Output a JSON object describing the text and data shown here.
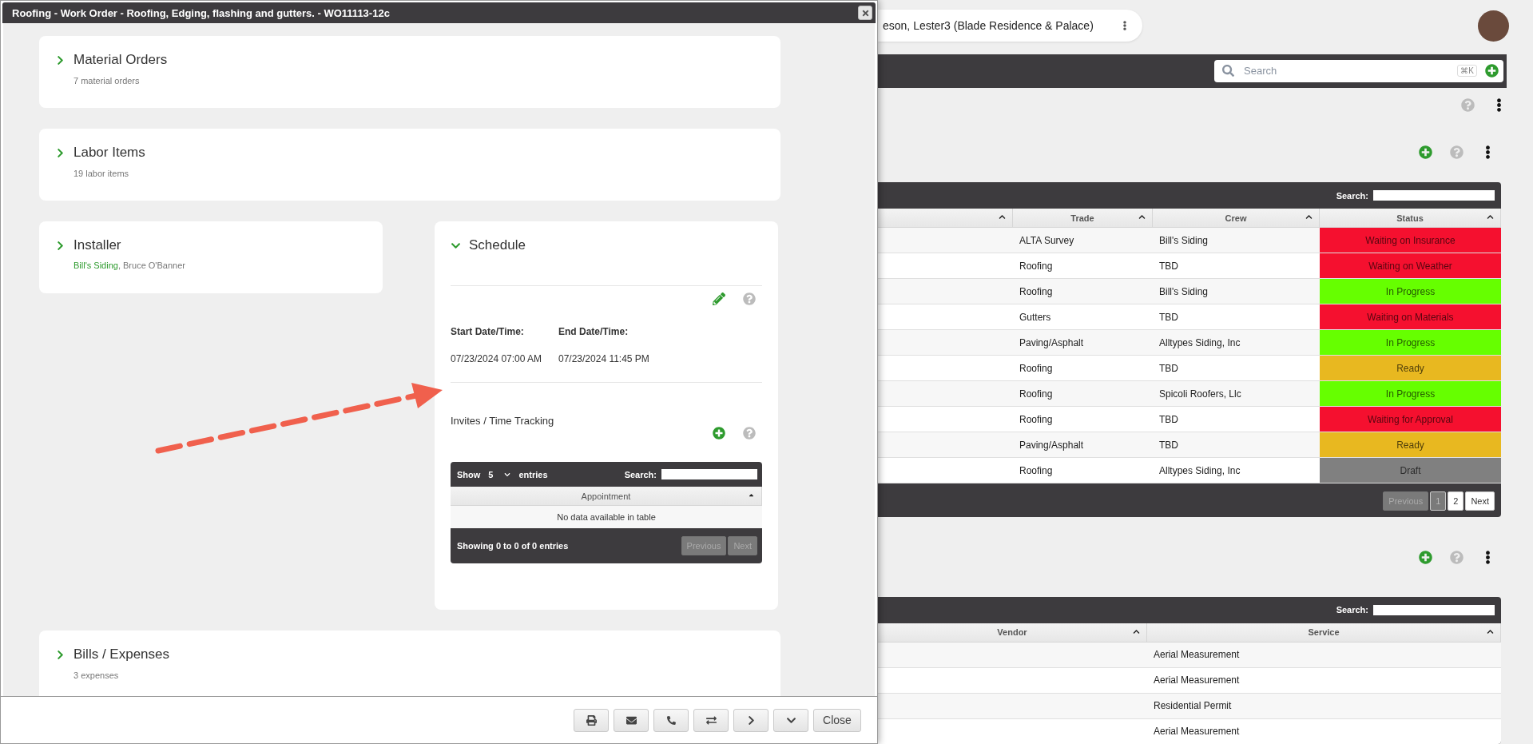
{
  "dialog": {
    "title": "Roofing - Work Order - Roofing, Edging, flashing and gutters. - WO11113-12c",
    "sections": [
      {
        "title": "Material Orders",
        "summary": "7 material orders",
        "expanded": false
      },
      {
        "title": "Labor Items",
        "summary": "19 labor items",
        "expanded": false
      }
    ],
    "installer": {
      "title": "Installer",
      "expanded": false,
      "company": "Bill's Siding",
      "rest": ", Bruce O'Banner"
    },
    "schedule": {
      "title": "Schedule",
      "expanded": true,
      "start_label": "Start Date/Time:",
      "start_value": "07/23/2024 07:00 AM",
      "end_label": "End Date/Time:",
      "end_value": "07/23/2024 11:45 PM",
      "invites_title": "Invites / Time Tracking",
      "table": {
        "show_label": "Show",
        "page_size": "5",
        "entries_label": "entries",
        "search_label": "Search:",
        "columns": [
          "Appointment"
        ],
        "empty_message": "No data available in table",
        "info": "Showing 0 to 0 of 0 entries",
        "buttons": [
          {
            "label": "Previous",
            "disabled": true
          },
          {
            "label": "Next",
            "disabled": true
          }
        ]
      }
    },
    "bills": {
      "title": "Bills / Expenses",
      "summary": "3 expenses",
      "expanded": false
    },
    "footer_buttons": [
      {
        "kind": "print"
      },
      {
        "kind": "email"
      },
      {
        "kind": "phone"
      },
      {
        "kind": "swap"
      },
      {
        "kind": "next"
      },
      {
        "kind": "more"
      },
      {
        "kind": "text",
        "label": "Close"
      }
    ]
  },
  "page": {
    "context": "eson, Lester3 (Blade Residence & Palace)",
    "search": {
      "placeholder": "Search",
      "shortcut": "⌘K"
    },
    "work_orders": {
      "search_label": "Search:",
      "columns": [
        "Trade",
        "Crew",
        "Status"
      ],
      "rows": [
        {
          "trade": "ALTA Survey",
          "crew": "Bill's Siding",
          "status": "Waiting on Insurance",
          "color": "#f5102f"
        },
        {
          "trade": "Roofing",
          "crew": "TBD",
          "status": "Waiting on Weather",
          "color": "#f5102f"
        },
        {
          "trade": "Roofing",
          "crew": "Bill's Siding",
          "status": "In Progress",
          "color": "#66ff00"
        },
        {
          "trade": "Gutters",
          "crew": "TBD",
          "status": "Waiting on Materials",
          "color": "#f5102f"
        },
        {
          "trade": "Paving/Asphalt",
          "crew": "Alltypes Siding, Inc",
          "status": "In Progress",
          "color": "#66ff00"
        },
        {
          "trade": "Roofing",
          "crew": "TBD",
          "status": "Ready",
          "color": "#e8b820"
        },
        {
          "trade": "Roofing",
          "crew": "Spicoli Roofers, Llc",
          "status": "In Progress",
          "color": "#66ff00"
        },
        {
          "trade": "Roofing",
          "crew": "TBD",
          "status": "Waiting for Approval",
          "color": "#f5102f"
        },
        {
          "trade": "Paving/Asphalt",
          "crew": "TBD",
          "status": "Ready",
          "color": "#e8b820"
        },
        {
          "trade": "Roofing",
          "crew": "Alltypes Siding, Inc",
          "status": "Draft",
          "color": "#808080"
        }
      ],
      "previous": {
        "label": "Previous",
        "disabled": true
      },
      "pages": [
        {
          "label": "1",
          "selected": true
        },
        {
          "label": "2",
          "selected": false
        }
      ],
      "next": {
        "label": "Next",
        "disabled": false
      }
    },
    "expenses": {
      "search_label": "Search:",
      "columns": [
        "Vendor",
        "Service"
      ],
      "rows": [
        {
          "service": "Aerial Measurement"
        },
        {
          "service": "Aerial Measurement"
        },
        {
          "service": "Residential Permit"
        },
        {
          "service": "Aerial Measurement"
        }
      ]
    }
  }
}
